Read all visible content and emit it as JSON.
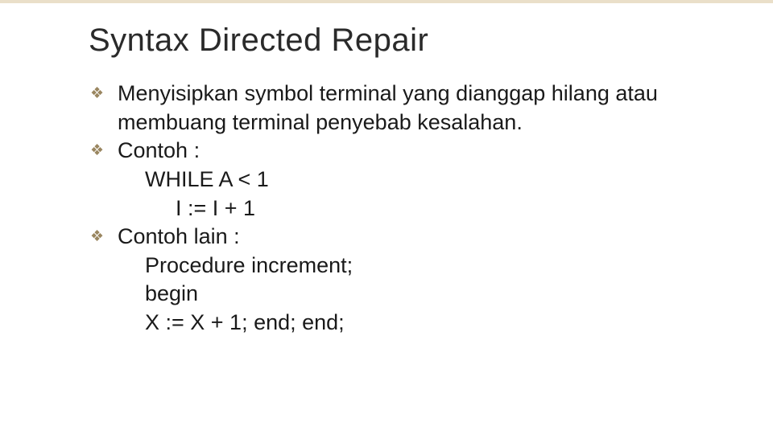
{
  "title": "Syntax Directed Repair",
  "bullets": [
    {
      "text": "Menyisipkan symbol terminal yang dianggap hilang atau membuang terminal penyebab kesalahan.",
      "sublines": []
    },
    {
      "text": "Contoh :",
      "sublines": [
        {
          "text": "WHILE A < 1",
          "indent": 1
        },
        {
          "text": "I := I + 1",
          "indent": 2
        }
      ]
    },
    {
      "text": "Contoh lain :",
      "sublines": [
        {
          "text": "Procedure increment;",
          "indent": 1
        },
        {
          "text": "begin",
          "indent": 1
        },
        {
          "text": "X := X + 1; end; end;",
          "indent": 1
        }
      ]
    }
  ],
  "bullet_glyph": "❖"
}
